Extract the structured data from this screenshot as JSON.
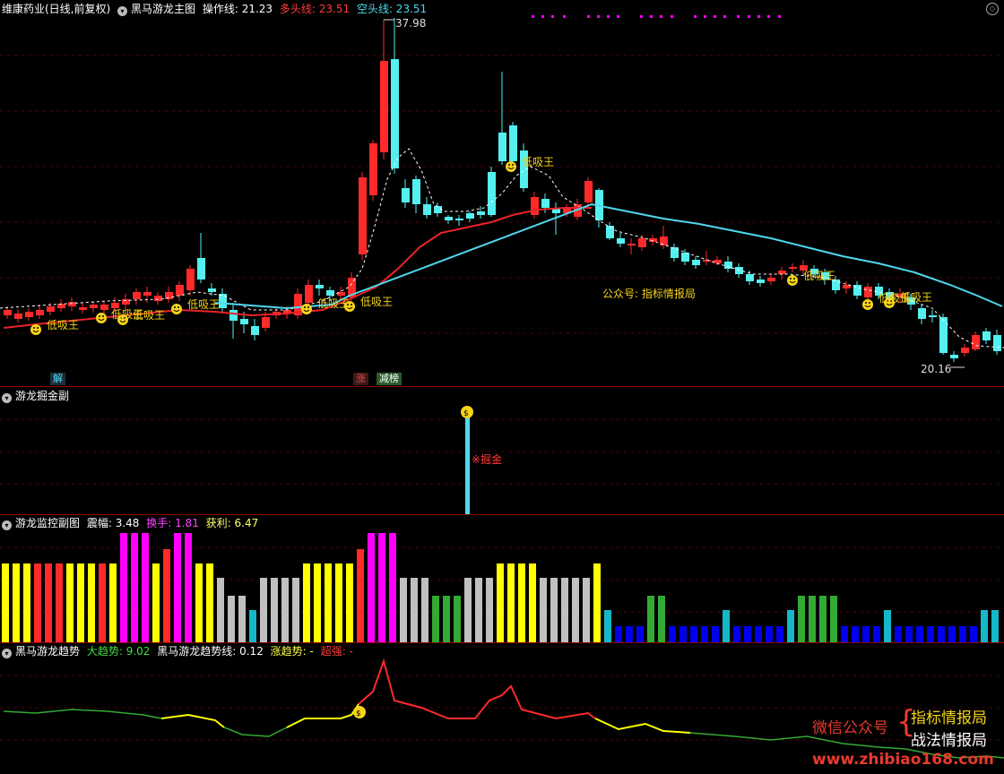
{
  "main": {
    "stock": "维康药业(日线,前复权)",
    "indicator": "黑马游龙主图",
    "op_label": "操作线: 21.23",
    "long_label": "多头线: 23.51",
    "short_label": "空头线: 23.51",
    "high_price": "37.98",
    "low_price": "20.16",
    "signal_label": "低吸王",
    "gzh_label": "公众号: 指标情报局",
    "badge_jie": "解",
    "badge_zhang": "涨",
    "badge_rank": "减榜"
  },
  "pane2": {
    "title": "游龙掘金副",
    "signal": "※掘金"
  },
  "pane3": {
    "title": "游龙监控副图",
    "amp": "震幅: 3.48",
    "turn": "换手: 1.81",
    "profit": "获利: 6.47"
  },
  "pane4": {
    "title": "黑马游龙趋势",
    "big": "大趋势: 9.02",
    "line": "黑马游龙趋势线: 0.12",
    "rise": "涨趋势: -",
    "strong": "超强: -"
  },
  "watermark": {
    "wx": "微信公众号",
    "a": "指标情报局",
    "b": "战法情报局",
    "site": "www.zhibiao168.com"
  },
  "colors": {
    "up": "#ff2a2a",
    "down": "#54f0f0",
    "ma_cyan": "#4fd8ee",
    "ma_red": "#e8232a",
    "yellow": "#ffff00",
    "magenta": "#ff00ff",
    "gray": "#c0c0c0",
    "green": "#33aa33",
    "blue": "#0000ee"
  }
}
